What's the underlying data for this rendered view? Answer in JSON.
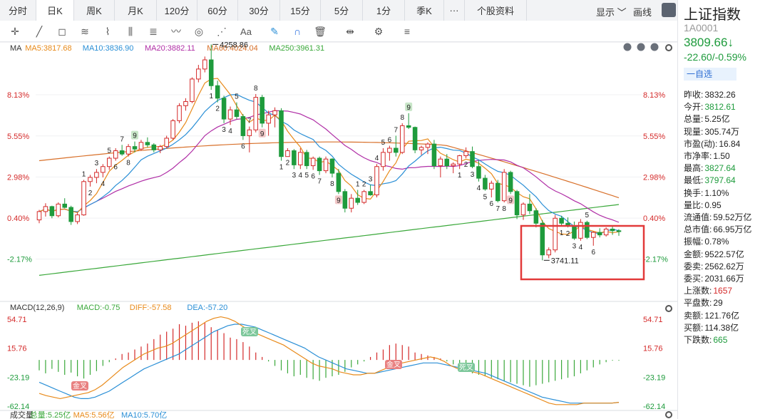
{
  "tabs": [
    "分时",
    "日K",
    "周K",
    "月K",
    "120分",
    "60分",
    "30分",
    "15分",
    "5分",
    "1分",
    "季K",
    "···",
    "个股资料"
  ],
  "selected_tab": "日K",
  "display_menu": "显示 ﹀",
  "draw_label": "画线",
  "toolbar_icons": [
    "crosshair-icon",
    "line-icon",
    "rect-icon",
    "fan-icon",
    "wave-icon",
    "gann-icon",
    "fib-icon",
    "pattern-icon",
    "cycle-icon",
    "angle-icon",
    "text-icon",
    "pen-icon",
    "magnet-icon",
    "trash-icon",
    "eye-icon",
    "gear-icon",
    "layers-icon"
  ],
  "text_tool_label": "Aa",
  "ma_legend": {
    "label": "MA",
    "items": [
      {
        "text": "MA5:3817.68",
        "color": "#e88a1a"
      },
      {
        "text": "MA10:3836.90",
        "color": "#2a8fd6"
      },
      {
        "text": "MA20:3882.11",
        "color": "#b02ea6"
      },
      {
        "text": "MA60:4024.04",
        "color": "#d8702a"
      },
      {
        "text": "MA250:3961.31",
        "color": "#3aa83a"
      }
    ]
  },
  "macd_legend": {
    "label": "MACD(12,26,9)",
    "items": [
      {
        "text": "MACD:-0.75",
        "color": "#3aa83a"
      },
      {
        "text": "DIFF:-57.58",
        "color": "#e88a1a"
      },
      {
        "text": "DEA:-57.20",
        "color": "#2a8fd6"
      }
    ]
  },
  "vol_legend": {
    "label": "成交量",
    "items": [
      {
        "text": "总量:5.25亿",
        "color": "#3aa83a"
      },
      {
        "text": "MA5:5.56亿",
        "color": "#e88a1a"
      },
      {
        "text": "MA10:5.70亿",
        "color": "#2a8fd6"
      }
    ]
  },
  "chart_data": {
    "type": "candlestick",
    "price_axis_labels": [
      "8.13%",
      "5.55%",
      "2.98%",
      "0.40%",
      "-2.17%"
    ],
    "price_axis_values": [
      8.13,
      5.55,
      2.98,
      0.4,
      -2.17
    ],
    "price_range_percent": [
      -4.6,
      10.5
    ],
    "base_price": 3827,
    "high_annotation": "4258.86",
    "low_annotation": "3741.11",
    "candles": [
      [
        3838,
        3862,
        3830,
        3858
      ],
      [
        3858,
        3878,
        3846,
        3870
      ],
      [
        3870,
        3872,
        3842,
        3848
      ],
      [
        3848,
        3880,
        3844,
        3876
      ],
      [
        3876,
        3890,
        3866,
        3868
      ],
      [
        3868,
        3872,
        3826,
        3834
      ],
      [
        3834,
        3856,
        3828,
        3850
      ],
      [
        3850,
        3934,
        3848,
        3930
      ],
      [
        3930,
        3946,
        3918,
        3940
      ],
      [
        3940,
        3960,
        3926,
        3952
      ],
      [
        3952,
        3972,
        3940,
        3966
      ],
      [
        3966,
        3990,
        3958,
        3986
      ],
      [
        3986,
        4010,
        3980,
        4004
      ],
      [
        4004,
        4018,
        3992,
        3996
      ],
      [
        3996,
        4020,
        3990,
        4014
      ],
      [
        4014,
        4026,
        4000,
        4008
      ],
      [
        4008,
        4030,
        4004,
        4024
      ],
      [
        4024,
        4036,
        4012,
        4018
      ],
      [
        4018,
        4022,
        4000,
        4006
      ],
      [
        4006,
        4018,
        3998,
        4014
      ],
      [
        4014,
        4040,
        4010,
        4034
      ],
      [
        4034,
        4080,
        4030,
        4076
      ],
      [
        4076,
        4118,
        4070,
        4112
      ],
      [
        4112,
        4130,
        4100,
        4122
      ],
      [
        4122,
        4180,
        4118,
        4176
      ],
      [
        4176,
        4210,
        4168,
        4200
      ],
      [
        4200,
        4230,
        4192,
        4222
      ],
      [
        4222,
        4259,
        4150,
        4160
      ],
      [
        4160,
        4172,
        4120,
        4130
      ],
      [
        4130,
        4136,
        4070,
        4080
      ],
      [
        4080,
        4110,
        4066,
        4102
      ],
      [
        4102,
        4120,
        4080,
        4086
      ],
      [
        4086,
        4092,
        4030,
        4040
      ],
      [
        4040,
        4062,
        4000,
        4054
      ],
      [
        4054,
        4140,
        4048,
        4132
      ],
      [
        4132,
        4138,
        4060,
        4070
      ],
      [
        4070,
        4100,
        4040,
        4090
      ],
      [
        4090,
        4108,
        4060,
        4100
      ],
      [
        4100,
        4106,
        3980,
        3990
      ],
      [
        3990,
        4010,
        3990,
        4004
      ],
      [
        4004,
        4008,
        3960,
        3970
      ],
      [
        3970,
        4010,
        3960,
        4000
      ],
      [
        4000,
        4006,
        3960,
        3968
      ],
      [
        3968,
        3990,
        3958,
        3986
      ],
      [
        3986,
        3990,
        3946,
        3956
      ],
      [
        3956,
        3990,
        3950,
        3984
      ],
      [
        3984,
        3986,
        3940,
        3950
      ],
      [
        3950,
        3960,
        3900,
        3906
      ],
      [
        3906,
        3912,
        3856,
        3866
      ],
      [
        3866,
        3900,
        3856,
        3890
      ],
      [
        3890,
        3910,
        3874,
        3880
      ],
      [
        3880,
        3910,
        3876,
        3906
      ],
      [
        3906,
        3922,
        3896,
        3898
      ],
      [
        3898,
        3972,
        3892,
        3966
      ],
      [
        3966,
        4010,
        3956,
        4000
      ],
      [
        4000,
        4016,
        3980,
        4010
      ],
      [
        4010,
        4040,
        3990,
        4000
      ],
      [
        4000,
        4070,
        3996,
        4064
      ],
      [
        4064,
        4094,
        4056,
        4060
      ],
      [
        4060,
        4062,
        3998,
        4006
      ],
      [
        4006,
        4016,
        3994,
        4012
      ],
      [
        4012,
        4024,
        3996,
        4020
      ],
      [
        4020,
        4030,
        3960,
        3968
      ],
      [
        3968,
        3990,
        3940,
        3984
      ],
      [
        3984,
        3996,
        3960,
        3968
      ],
      [
        3968,
        3976,
        3950,
        3972
      ],
      [
        3972,
        3994,
        3960,
        3992
      ],
      [
        3992,
        4012,
        3986,
        4002
      ],
      [
        4002,
        4014,
        3962,
        3966
      ],
      [
        3966,
        3980,
        3930,
        3938
      ],
      [
        3938,
        3946,
        3908,
        3912
      ],
      [
        3912,
        3932,
        3892,
        3926
      ],
      [
        3926,
        3934,
        3880,
        3884
      ],
      [
        3884,
        3960,
        3880,
        3952
      ],
      [
        3952,
        3956,
        3900,
        3906
      ],
      [
        3906,
        3910,
        3840,
        3850
      ],
      [
        3850,
        3880,
        3838,
        3876
      ],
      [
        3876,
        3900,
        3852,
        3860
      ],
      [
        3860,
        3866,
        3820,
        3830
      ],
      [
        3830,
        3838,
        3741,
        3754
      ],
      [
        3754,
        3772,
        3746,
        3766
      ],
      [
        3766,
        3850,
        3760,
        3842
      ],
      [
        3842,
        3848,
        3822,
        3830
      ],
      [
        3830,
        3844,
        3820,
        3824
      ],
      [
        3824,
        3834,
        3790,
        3794
      ],
      [
        3794,
        3840,
        3788,
        3832
      ],
      [
        3832,
        3836,
        3792,
        3796
      ],
      [
        3796,
        3810,
        3776,
        3808
      ],
      [
        3808,
        3818,
        3796,
        3802
      ],
      [
        3802,
        3820,
        3798,
        3816
      ],
      [
        3816,
        3822,
        3802,
        3812
      ],
      [
        3812,
        3816,
        3800,
        3810
      ]
    ],
    "macd_axis_labels": [
      "54.71",
      "15.76",
      "-23.19",
      "-62.14"
    ],
    "macd_range": [
      -62.14,
      54.71
    ],
    "macd_hist": [
      -14,
      -18,
      -12,
      -16,
      -20,
      -17,
      -22,
      -25,
      -20,
      -15,
      -8,
      -3,
      2,
      8,
      10,
      14,
      18,
      22,
      28,
      34,
      38,
      42,
      48,
      46,
      50,
      52,
      50,
      44,
      40,
      36,
      30,
      28,
      24,
      18,
      10,
      4,
      -2,
      -8,
      -14,
      -18,
      -22,
      -20,
      -24,
      -26,
      -28,
      -24,
      -22,
      -20,
      -16,
      -10,
      -6,
      -2,
      4,
      10,
      14,
      20,
      22,
      20,
      18,
      10,
      8,
      6,
      4,
      2,
      -2,
      -6,
      -10,
      -14,
      -18,
      -20,
      -22,
      -24,
      -26,
      -28,
      -30,
      -32,
      -34,
      -36,
      -34,
      -32,
      -30,
      -28,
      -26,
      -24,
      -22,
      -18,
      -14,
      -10,
      -6,
      -3,
      -1,
      -1
    ],
    "diff_series": [
      -45,
      -48,
      -50,
      -52,
      -50,
      -48,
      -46,
      -44,
      -40,
      -34,
      -26,
      -18,
      -10,
      -4,
      2,
      8,
      12,
      16,
      18,
      22,
      28,
      34,
      40,
      46,
      52,
      56,
      58,
      56,
      52,
      46,
      40,
      36,
      32,
      28,
      24,
      20,
      14,
      8,
      2,
      -4,
      -8,
      -10,
      -12,
      -16,
      -18,
      -20,
      -20,
      -18,
      -18,
      -14,
      -10,
      -6,
      -4,
      -2,
      0,
      2,
      4,
      2,
      -2,
      -8,
      -12,
      -14,
      -16,
      -18,
      -22,
      -26,
      -30,
      -34,
      -38,
      -42,
      -46,
      -50,
      -54,
      -58,
      -60,
      -60,
      -60,
      -60,
      -58,
      -58,
      -58,
      -58,
      -58,
      -57
    ],
    "dea_series": [
      -30,
      -34,
      -38,
      -42,
      -46,
      -50,
      -52,
      -52,
      -50,
      -46,
      -42,
      -36,
      -30,
      -24,
      -18,
      -12,
      -8,
      -4,
      0,
      4,
      8,
      14,
      20,
      26,
      32,
      38,
      42,
      46,
      48,
      48,
      46,
      44,
      40,
      36,
      32,
      28,
      24,
      20,
      16,
      10,
      4,
      0,
      -4,
      -8,
      -12,
      -14,
      -16,
      -18,
      -18,
      -16,
      -14,
      -12,
      -10,
      -8,
      -6,
      -4,
      -4,
      -4,
      -6,
      -8,
      -10,
      -12,
      -14,
      -16,
      -18,
      -22,
      -26,
      -30,
      -34,
      -38,
      -42,
      -46,
      -50,
      -52,
      -54,
      -56,
      -58,
      -58,
      -58,
      -58,
      -58,
      -58,
      -58,
      -57
    ]
  },
  "candle_labels": {
    "n1": "1",
    "n2": "2",
    "n3": "3",
    "n4": "4",
    "n5": "5",
    "n6": "6",
    "n7": "7",
    "n8": "8",
    "n9": "9"
  },
  "signal_badges": {
    "golden_cross": "金叉",
    "dead_cross": "死叉"
  },
  "sidebar": {
    "name": "上证指数",
    "code": "1A0001",
    "price": "3809.66↓",
    "change": "-22.60/-0.59%",
    "watch_button": "一自选",
    "stats": [
      {
        "label": "昨收:",
        "value": "3832.26",
        "color": "#222"
      },
      {
        "label": "今开:",
        "value": "3812.61",
        "color": "#1e9b3c"
      },
      {
        "label": "总量:",
        "value": "5.25亿",
        "color": "#222"
      },
      {
        "label": "现量:",
        "value": "305.74万",
        "color": "#222"
      },
      {
        "label": "市盈(动):",
        "value": "16.84",
        "color": "#222"
      },
      {
        "label": "市净率:",
        "value": "1.50",
        "color": "#222"
      },
      {
        "label": "最高:",
        "value": "3827.64",
        "color": "#1e9b3c"
      },
      {
        "label": "最低:",
        "value": "3797.64",
        "color": "#1e9b3c"
      },
      {
        "label": "换手:",
        "value": "1.10%",
        "color": "#222"
      },
      {
        "label": "量比:",
        "value": "0.95",
        "color": "#222"
      },
      {
        "label": "流通值:",
        "value": "59.52万亿",
        "color": "#222"
      },
      {
        "label": "总市值:",
        "value": "66.95万亿",
        "color": "#222"
      },
      {
        "label": "振幅:",
        "value": "0.78%",
        "color": "#222"
      },
      {
        "label": "金额:",
        "value": "9522.57亿",
        "color": "#222"
      },
      {
        "label": "委卖:",
        "value": "2562.62万",
        "color": "#222"
      },
      {
        "label": "委买:",
        "value": "2031.66万",
        "color": "#222"
      },
      {
        "label": "上涨数:",
        "value": "1657",
        "color": "#d42a2a"
      },
      {
        "label": "平盘数:",
        "value": "29",
        "color": "#222"
      },
      {
        "label": "卖额:",
        "value": "121.76亿",
        "color": "#222"
      },
      {
        "label": "买额:",
        "value": "114.38亿",
        "color": "#222"
      },
      {
        "label": "下跌数:",
        "value": "665",
        "color": "#1e9b3c"
      }
    ]
  }
}
